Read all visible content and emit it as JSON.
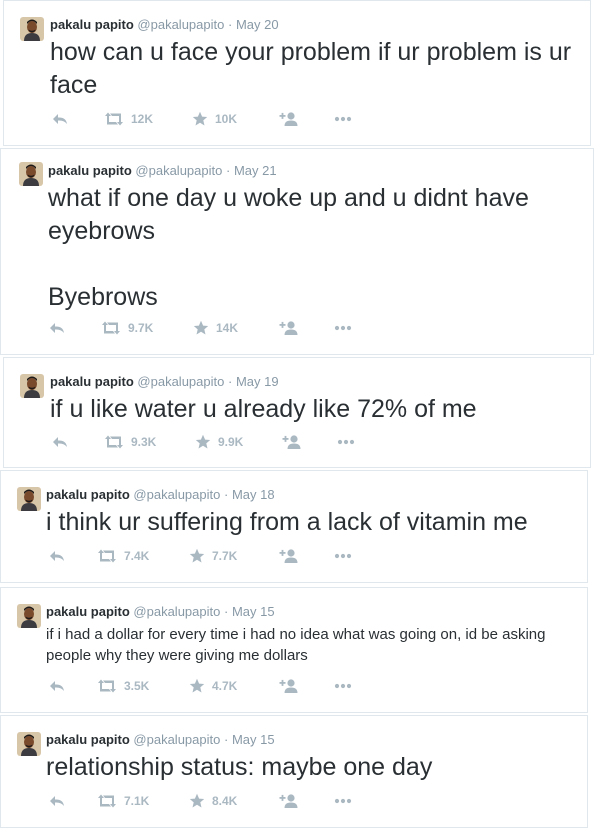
{
  "colors": {
    "name": "#292f33",
    "meta": "#8899a6",
    "action": "#aab8c2",
    "border": "#e1e8ed"
  },
  "icons": [
    "reply-icon",
    "retweet-icon",
    "favorite-icon",
    "follow-icon",
    "more-icon"
  ],
  "tweets": [
    {
      "name": "pakalu papito",
      "handle": "@pakalupapito",
      "sep": "·",
      "date": "May 20",
      "text": "how can u face your problem if ur problem is ur face",
      "retweets": "12K",
      "favorites": "10K"
    },
    {
      "name": "pakalu papito",
      "handle": "@pakalupapito",
      "sep": "·",
      "date": "May 21",
      "text": "what if one day u woke up and u didnt have eyebrows\n\nByebrows",
      "retweets": "9.7K",
      "favorites": "14K"
    },
    {
      "name": "pakalu papito",
      "handle": "@pakalupapito",
      "sep": "·",
      "date": "May 19",
      "text": "if u like water u already like 72% of me",
      "retweets": "9.3K",
      "favorites": "9.9K"
    },
    {
      "name": "pakalu papito",
      "handle": "@pakalupapito",
      "sep": "·",
      "date": "May 18",
      "text": "i think ur suffering from a lack of vitamin me",
      "retweets": "7.4K",
      "favorites": "7.7K"
    },
    {
      "name": "pakalu papito",
      "handle": "@pakalupapito",
      "sep": "·",
      "date": "May 15",
      "text": "if i had a dollar for every time i had no idea what was going on, id be asking people why they were giving me dollars",
      "retweets": "3.5K",
      "favorites": "4.7K"
    },
    {
      "name": "pakalu papito",
      "handle": "@pakalupapito",
      "sep": "·",
      "date": "May 15",
      "text": "relationship status: maybe one day",
      "retweets": "7.1K",
      "favorites": "8.4K"
    }
  ]
}
